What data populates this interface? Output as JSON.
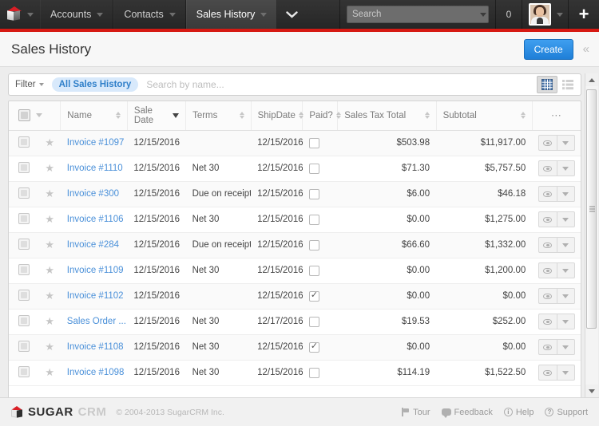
{
  "navbar": {
    "logo_icon": "sugarcrm-cube-logo",
    "logo_caret_icon": "chevron-down-icon",
    "modules": [
      {
        "label": "Accounts",
        "active": false
      },
      {
        "label": "Contacts",
        "active": false
      },
      {
        "label": "Sales History",
        "active": true
      }
    ],
    "more_chevron_icon": "chevron-down-icon",
    "search": {
      "placeholder": "Search",
      "value": "",
      "icon": "search-icon",
      "caret_icon": "chevron-down-icon"
    },
    "notification_count": "0",
    "avatar_icon": "user-avatar",
    "avatar_caret_icon": "chevron-down-icon",
    "quick_create_label": "+",
    "accent_color": "#d61a13"
  },
  "page_header": {
    "title": "Sales History",
    "create_label": "Create",
    "create_color": "#2a8fe8",
    "collapse_icon": "chevron-double-left-icon"
  },
  "filter_bar": {
    "filter_label": "Filter",
    "filter_caret_icon": "chevron-down-icon",
    "active_filter": "All Sales History",
    "search_placeholder": "Search by name...",
    "search_value": "",
    "view_grid_icon": "grid-view-icon",
    "view_list_icon": "list-view-icon",
    "active_view": "grid"
  },
  "table": {
    "select_all_icon": "checkbox-icon",
    "select_all_caret_icon": "chevron-down-icon",
    "actions_menu_icon": "ellipsis-icon",
    "columns": [
      {
        "label": "Name",
        "sort": "none",
        "align": "left"
      },
      {
        "label": "Sale Date",
        "sort": "desc",
        "align": "left"
      },
      {
        "label": "Terms",
        "sort": "none",
        "align": "left"
      },
      {
        "label": "ShipDate",
        "sort": "none",
        "align": "left"
      },
      {
        "label": "Paid?",
        "sort": "none",
        "align": "left"
      },
      {
        "label": "Sales Tax Total",
        "sort": "none",
        "align": "right"
      },
      {
        "label": "Subtotal",
        "sort": "none",
        "align": "right"
      }
    ],
    "rows": [
      {
        "name": "Invoice #1097",
        "sale_date": "12/15/2016",
        "terms": "",
        "ship_date": "12/15/2016",
        "paid": false,
        "sales_tax_total": "$503.98",
        "subtotal": "$11,917.00"
      },
      {
        "name": "Invoice #1110",
        "sale_date": "12/15/2016",
        "terms": "Net 30",
        "ship_date": "12/15/2016",
        "paid": false,
        "sales_tax_total": "$71.30",
        "subtotal": "$5,757.50"
      },
      {
        "name": "Invoice #300",
        "sale_date": "12/15/2016",
        "terms": "Due on receipt",
        "ship_date": "12/15/2016",
        "paid": false,
        "sales_tax_total": "$6.00",
        "subtotal": "$46.18"
      },
      {
        "name": "Invoice #1106",
        "sale_date": "12/15/2016",
        "terms": "Net 30",
        "ship_date": "12/15/2016",
        "paid": false,
        "sales_tax_total": "$0.00",
        "subtotal": "$1,275.00"
      },
      {
        "name": "Invoice #284",
        "sale_date": "12/15/2016",
        "terms": "Due on receipt",
        "ship_date": "12/15/2016",
        "paid": false,
        "sales_tax_total": "$66.60",
        "subtotal": "$1,332.00"
      },
      {
        "name": "Invoice #1109",
        "sale_date": "12/15/2016",
        "terms": "Net 30",
        "ship_date": "12/15/2016",
        "paid": false,
        "sales_tax_total": "$0.00",
        "subtotal": "$1,200.00"
      },
      {
        "name": "Invoice #1102",
        "sale_date": "12/15/2016",
        "terms": "",
        "ship_date": "12/15/2016",
        "paid": true,
        "sales_tax_total": "$0.00",
        "subtotal": "$0.00"
      },
      {
        "name": "Sales Order ...",
        "sale_date": "12/15/2016",
        "terms": "Net 30",
        "ship_date": "12/17/2016",
        "paid": false,
        "sales_tax_total": "$19.53",
        "subtotal": "$252.00"
      },
      {
        "name": "Invoice #1108",
        "sale_date": "12/15/2016",
        "terms": "Net 30",
        "ship_date": "12/15/2016",
        "paid": true,
        "sales_tax_total": "$0.00",
        "subtotal": "$0.00"
      },
      {
        "name": "Invoice #1098",
        "sale_date": "12/15/2016",
        "terms": "Net 30",
        "ship_date": "12/15/2016",
        "paid": false,
        "sales_tax_total": "$114.19",
        "subtotal": "$1,522.50"
      }
    ],
    "row_preview_icon": "eye-icon",
    "row_menu_icon": "chevron-down-icon",
    "row_select_icon": "checkbox-icon",
    "row_favorite_icon": "star-icon"
  },
  "scrollbar": {
    "up_icon": "triangle-up-icon",
    "down_icon": "triangle-down-icon",
    "thumb_icon": "scrollbar-thumb"
  },
  "footer": {
    "brand_primary": "SUGAR",
    "brand_secondary": "CRM",
    "logo_icon": "sugarcrm-cube-logo",
    "copyright": "© 2004-2013 SugarCRM Inc.",
    "links": [
      {
        "label": "Tour",
        "icon": "flag-icon"
      },
      {
        "label": "Feedback",
        "icon": "speech-bubble-icon"
      },
      {
        "label": "Help",
        "icon": "info-icon",
        "glyph": "i"
      },
      {
        "label": "Support",
        "icon": "question-icon",
        "glyph": "?"
      }
    ]
  }
}
